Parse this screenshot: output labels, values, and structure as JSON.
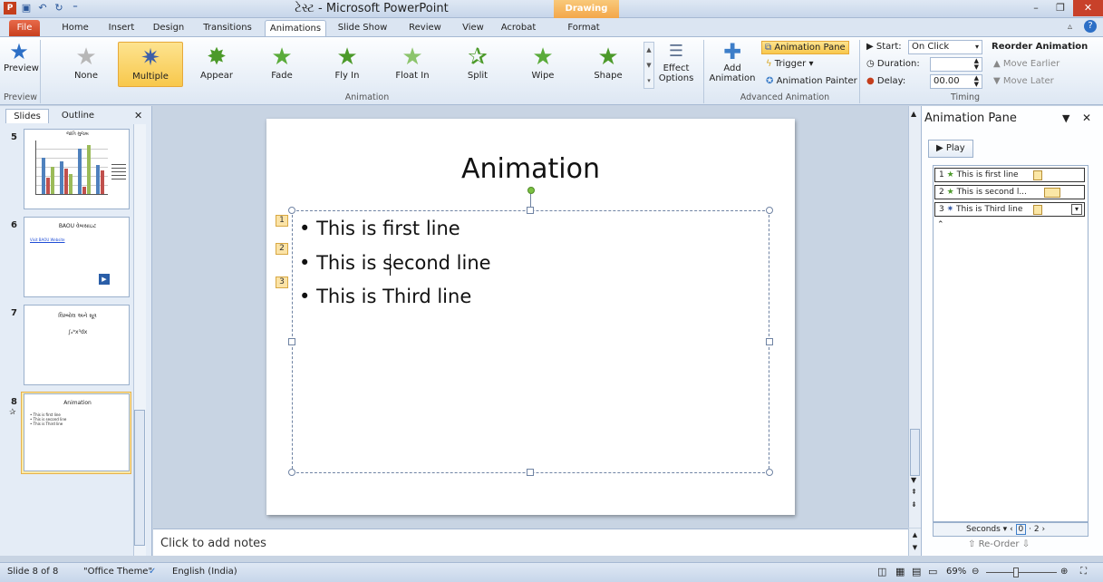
{
  "window": {
    "title": "ટેસ્ટ - Microsoft PowerPoint",
    "context_tab": "Drawing Tools"
  },
  "tabs": {
    "file": "File",
    "home": "Home",
    "insert": "Insert",
    "design": "Design",
    "transitions": "Transitions",
    "animations": "Animations",
    "slideshow": "Slide Show",
    "review": "Review",
    "view": "View",
    "acrobat": "Acrobat",
    "format": "Format"
  },
  "ribbon": {
    "preview": {
      "label": "Preview",
      "group": "Preview"
    },
    "gallery": [
      "None",
      "Multiple",
      "Appear",
      "Fade",
      "Fly In",
      "Float In",
      "Split",
      "Wipe",
      "Shape"
    ],
    "effect_options": "Effect Options",
    "animation_group": "Animation",
    "add_animation": "Add Animation",
    "animation_pane": "Animation Pane",
    "trigger": "Trigger",
    "animation_painter": "Animation Painter",
    "advanced_group": "Advanced Animation",
    "start_label": "Start:",
    "start_value": "On Click",
    "duration_label": "Duration:",
    "duration_value": "",
    "delay_label": "Delay:",
    "delay_value": "00.00",
    "reorder": "Reorder Animation",
    "move_earlier": "Move Earlier",
    "move_later": "Move Later",
    "timing_group": "Timing"
  },
  "left_panel": {
    "tab_slides": "Slides",
    "tab_outline": "Outline",
    "thumbs": [
      {
        "num": "5",
        "title": "જાતિ મુજબ"
      },
      {
        "num": "6",
        "title": "BAOU વેબસાઇટ",
        "link": "Visit BAOU Website"
      },
      {
        "num": "7",
        "title": "લિમ્બોલ અને સૂત્ર",
        "text": "∫ₐᵇx³dx"
      },
      {
        "num": "8",
        "title": "Animation",
        "lines": [
          "This is first line",
          "This is second line",
          "This is Third line"
        ]
      }
    ]
  },
  "slide": {
    "title": "Animation",
    "bullets": [
      "This is first line",
      "This is second line",
      "This is Third line"
    ],
    "tags": [
      "1",
      "2",
      "3"
    ]
  },
  "notes": {
    "placeholder": "Click to add notes"
  },
  "animation_pane": {
    "title": "Animation Pane",
    "play": "Play",
    "items": [
      {
        "num": "1",
        "text": "This is first line"
      },
      {
        "num": "2",
        "text": "This is second l..."
      },
      {
        "num": "3",
        "text": "This is Third line"
      }
    ],
    "seconds": "Seconds",
    "timeline_start": "0",
    "timeline_end": "2",
    "reorder": "Re-Order"
  },
  "status": {
    "slide": "Slide 8 of 8",
    "theme": "\"Office Theme\"",
    "language": "English (India)",
    "zoom": "69%"
  }
}
